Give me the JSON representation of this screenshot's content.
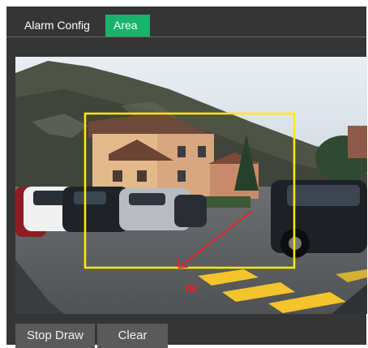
{
  "tabs": [
    {
      "label": "Alarm Config",
      "active": false
    },
    {
      "label": "Area",
      "active": true
    }
  ],
  "colors": {
    "panel_bg": "#353535",
    "active_tab": "#19b36b",
    "button_bg": "#5a5a5a",
    "region_outline": "#ffeb00",
    "direction_arrow": "#ff1a1a"
  },
  "video": {
    "direction_label": "IN"
  },
  "buttons": {
    "stop_draw": "Stop Draw",
    "clear": "Clear"
  }
}
